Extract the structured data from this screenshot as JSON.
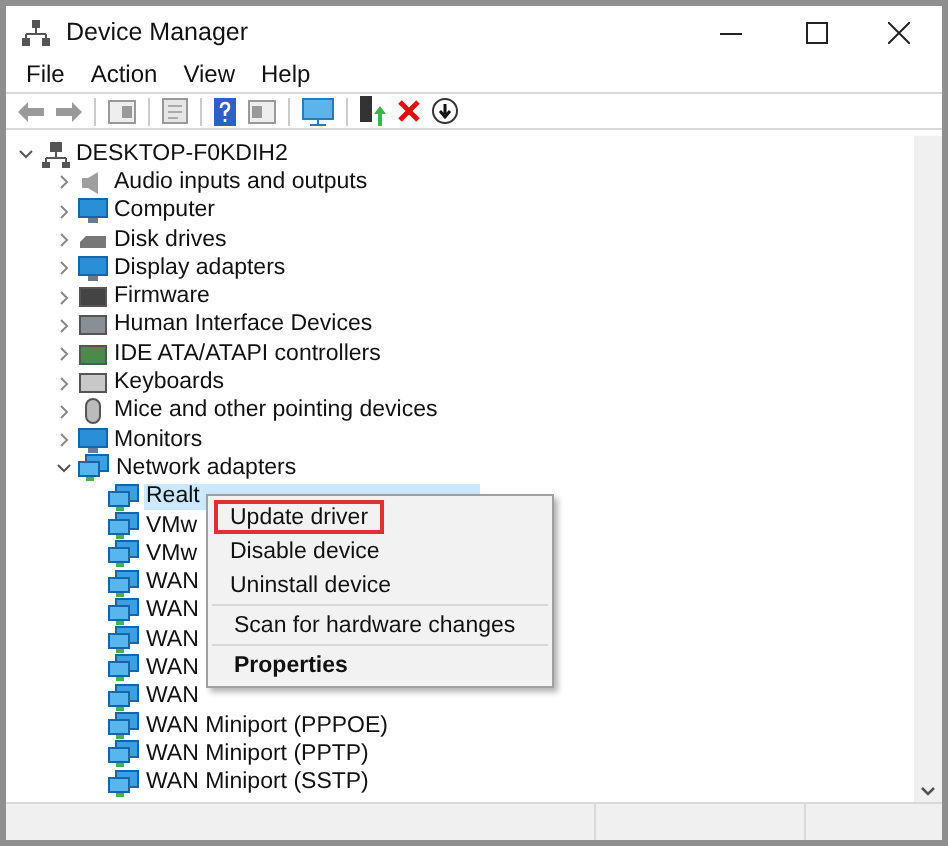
{
  "window": {
    "title": "Device Manager"
  },
  "menu_bar": [
    "File",
    "Action",
    "View",
    "Help"
  ],
  "tree": {
    "label": "DESKTOP-F0KDIH2",
    "expanded": true,
    "selected": false,
    "children": [
      {
        "label": "Audio inputs and outputs",
        "expanded": false,
        "selected": false
      },
      {
        "label": "Computer",
        "expanded": false,
        "selected": false
      },
      {
        "label": "Disk drives",
        "expanded": false,
        "selected": false
      },
      {
        "label": "Display adapters",
        "expanded": false,
        "selected": false
      },
      {
        "label": "Firmware",
        "expanded": false,
        "selected": false
      },
      {
        "label": "Human Interface Devices",
        "expanded": false,
        "selected": false
      },
      {
        "label": "IDE ATA/ATAPI controllers",
        "expanded": false,
        "selected": false
      },
      {
        "label": "Keyboards",
        "expanded": false,
        "selected": false
      },
      {
        "label": "Mice and other pointing devices",
        "expanded": false,
        "selected": false
      },
      {
        "label": "Monitors",
        "expanded": false,
        "selected": false
      },
      {
        "label": "Network adapters",
        "expanded": true,
        "selected": false,
        "children": [
          {
            "label": "Realt",
            "selected": true
          },
          {
            "label": "VMw",
            "selected": false
          },
          {
            "label": "VMw",
            "selected": false
          },
          {
            "label": "WAN",
            "selected": false
          },
          {
            "label": "WAN",
            "selected": false
          },
          {
            "label": "WAN",
            "selected": false
          },
          {
            "label": "WAN",
            "selected": false
          },
          {
            "label": "WAN",
            "selected": false
          },
          {
            "label": "WAN Miniport (PPPOE)",
            "selected": false
          },
          {
            "label": "WAN Miniport (PPTP)",
            "selected": false
          },
          {
            "label": "WAN Miniport (SSTP)",
            "selected": false
          }
        ]
      }
    ]
  },
  "context_menu": [
    [
      {
        "label": "Update driver",
        "highlighted": true,
        "default": false
      },
      {
        "label": "Disable device",
        "highlighted": false,
        "default": false
      },
      {
        "label": "Uninstall device",
        "highlighted": false,
        "default": false
      }
    ],
    [
      {
        "label": "Scan for hardware changes",
        "highlighted": false,
        "default": false
      }
    ],
    [
      {
        "label": "Properties",
        "highlighted": false,
        "default": true
      }
    ]
  ]
}
